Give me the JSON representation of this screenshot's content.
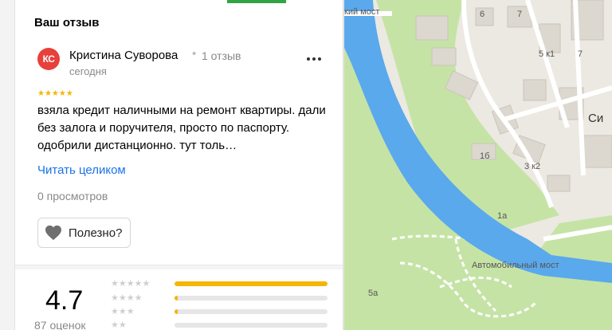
{
  "panel": {
    "section_title": "Ваш отзыв",
    "review": {
      "avatar_initials": "КС",
      "author": "Кристина Суворова",
      "reviews_count": "1 отзыв",
      "date": "сегодня",
      "rating": 5,
      "stars": "★★★★★",
      "text": "взяла кредит наличными на ремонт квартиры. дали без залога и поручителя, просто по паспорту. одобрили дистанционно. тут толь…",
      "read_more": "Читать целиком",
      "views": "0 просмотров",
      "useful_label": "Полезно?"
    },
    "summary": {
      "rating": "4.7",
      "count": "87 оценок",
      "distribution": [
        {
          "stars": "★★★★★",
          "fraction": 1.0
        },
        {
          "stars": "★★★★",
          "fraction": 0.02
        },
        {
          "stars": "★★★",
          "fraction": 0.02
        },
        {
          "stars": "★★",
          "fraction": 0.0
        }
      ]
    }
  },
  "map": {
    "labels": {
      "bridge_top": "кий мост",
      "car_bridge": "Автомобильный мост",
      "district": "Си",
      "n7a": "7",
      "n7b": "7",
      "n6": "6",
      "n5k1": "5 к1",
      "n1b": "1б",
      "n3k2": "3 к2",
      "n1a": "1а",
      "n5a": "5а"
    }
  },
  "colors": {
    "accent_green": "#32a442",
    "star": "#f6b500",
    "link": "#1a73e8",
    "avatar": "#e8403a",
    "river": "#5aa9ec",
    "park": "#c6e3a6"
  }
}
